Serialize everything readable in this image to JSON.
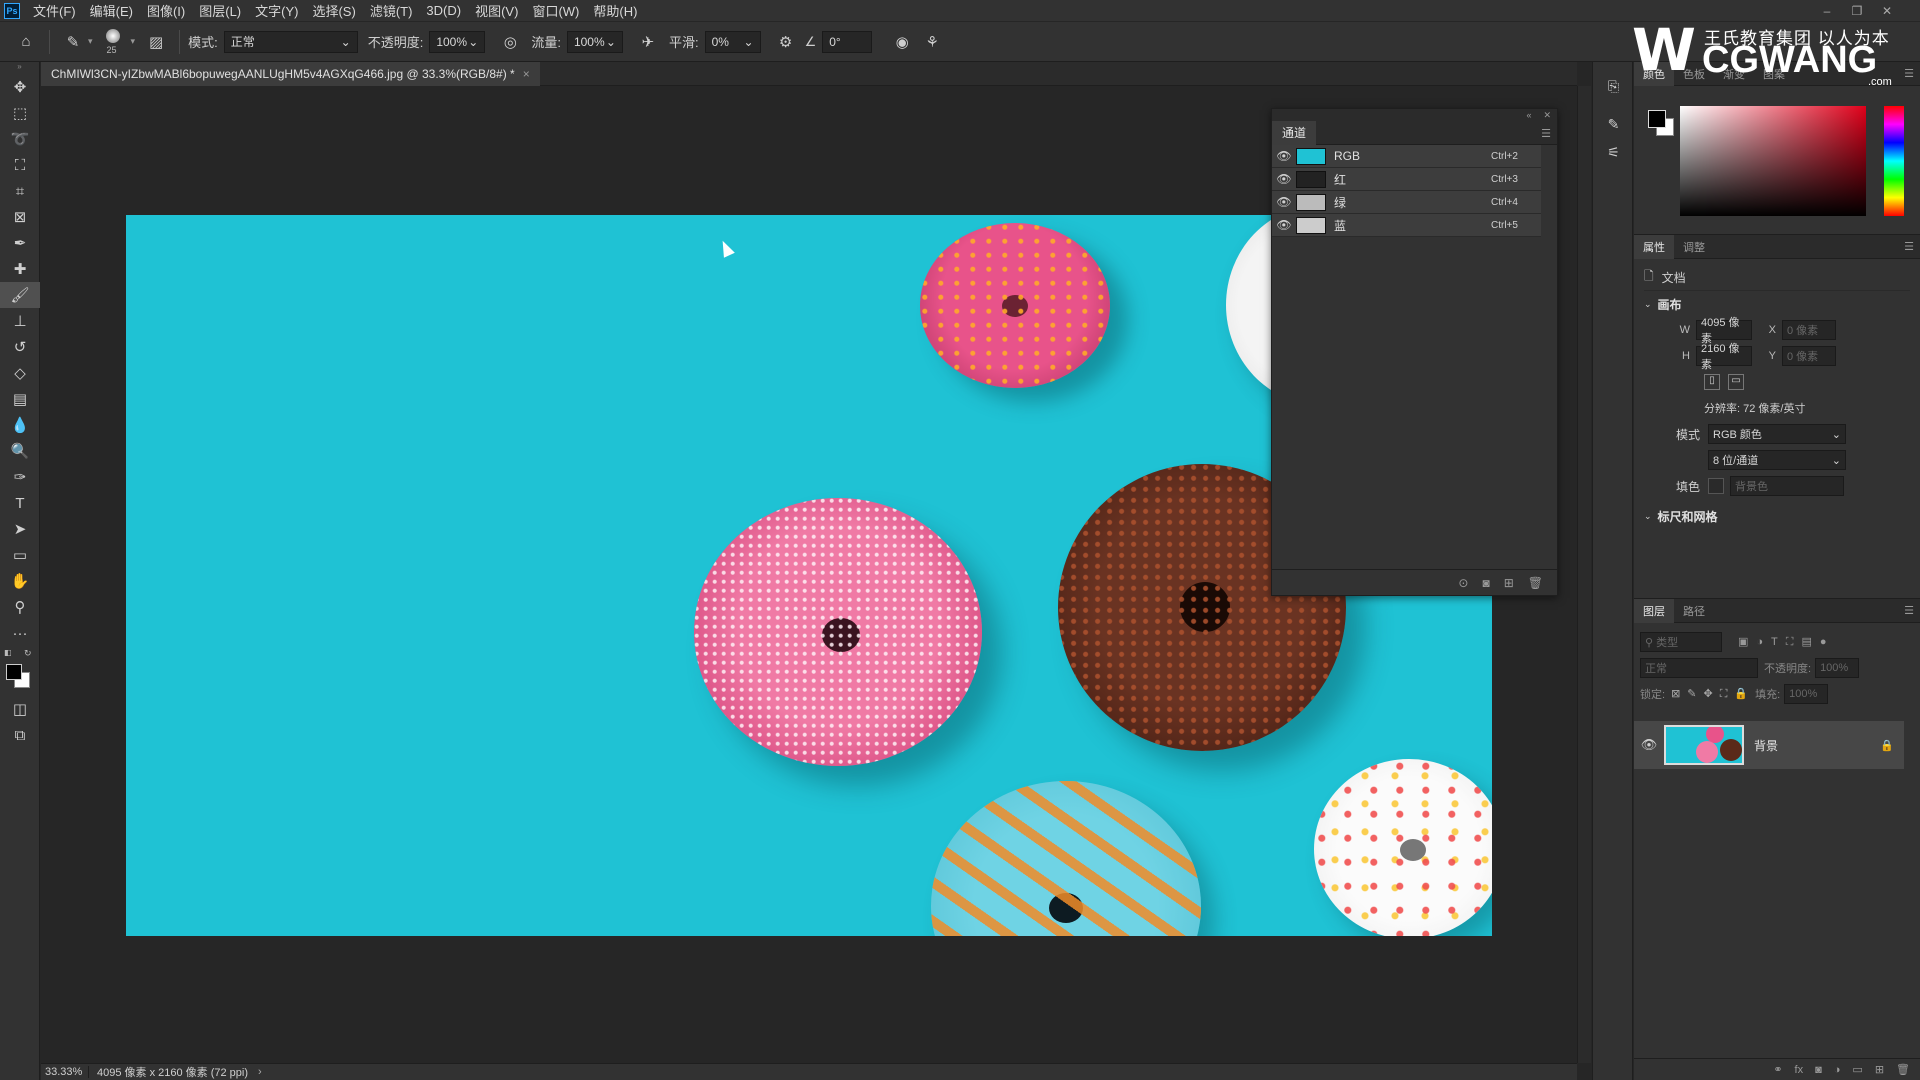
{
  "menubar": {
    "app_icon": "Ps",
    "items": [
      "文件(F)",
      "编辑(E)",
      "图像(I)",
      "图层(L)",
      "文字(Y)",
      "选择(S)",
      "滤镜(T)",
      "3D(D)",
      "视图(V)",
      "窗口(W)",
      "帮助(H)"
    ]
  },
  "options": {
    "brush_size": "25",
    "mode_label": "模式:",
    "mode_value": "正常",
    "opacity_label": "不透明度:",
    "opacity_value": "100%",
    "flow_label": "流量:",
    "flow_value": "100%",
    "smoothing_label": "平滑:",
    "smoothing_value": "0%",
    "angle_value": "0°"
  },
  "document": {
    "tab_title": "ChMIWl3CN-yIZbwMABl6bopuwegAANLUgHM5v4AGXqG466.jpg @ 33.3%(RGB/8#) *",
    "close": "×"
  },
  "status": {
    "zoom": "33.33%",
    "info": "4095 像素 x 2160 像素 (72 ppi)",
    "arrow": "›"
  },
  "channels": {
    "tab": "通道",
    "rows": [
      {
        "name": "RGB",
        "shortcut": "Ctrl+2"
      },
      {
        "name": "红",
        "shortcut": "Ctrl+3"
      },
      {
        "name": "绿",
        "shortcut": "Ctrl+4"
      },
      {
        "name": "蓝",
        "shortcut": "Ctrl+5"
      }
    ]
  },
  "color_panel": {
    "tabs": [
      "颜色",
      "色板",
      "渐变",
      "图案"
    ]
  },
  "properties": {
    "tabs": [
      "属性",
      "调整"
    ],
    "doc_label": "文档",
    "canvas_section": "画布",
    "w_label": "W",
    "w_value": "4095 像素",
    "h_label": "H",
    "h_value": "2160 像素",
    "x_label": "X",
    "x_value": "0 像素",
    "y_label": "Y",
    "y_value": "0 像素",
    "resolution": "分辨率: 72 像素/英寸",
    "mode_label": "模式",
    "mode_value": "RGB 颜色",
    "depth_value": "8 位/通道",
    "fill_label": "填色",
    "fill_value": "背景色",
    "rulers_section": "标尺和网格"
  },
  "layers": {
    "tabs": [
      "图层",
      "路径"
    ],
    "search_placeholder": "类型",
    "blend_mode": "正常",
    "opacity_label": "不透明度:",
    "opacity_value": "100%",
    "lock_label": "锁定:",
    "fill_label": "填充:",
    "fill_value": "100%",
    "layer_name": "背景"
  },
  "watermark": {
    "top_text": "王氏教育集团 以人为本",
    "main_text": "CGWANG",
    "sub_text": ".com"
  },
  "colors": {
    "canvas_bg": "#1fc2d4",
    "ui_dark": "#262626",
    "ui_panel": "#323232"
  }
}
